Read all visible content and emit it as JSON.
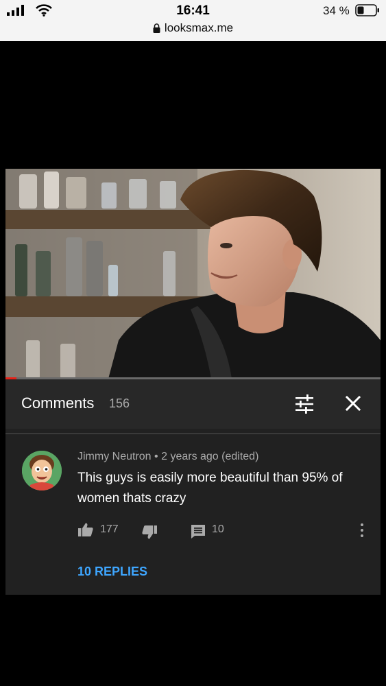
{
  "status_bar": {
    "time": "16:41",
    "url": "looksmax.me",
    "battery": "34 %",
    "icons": [
      "signal-icon",
      "wifi-icon",
      "lock-icon",
      "battery-icon"
    ]
  },
  "video": {
    "progress_fraction": 0.03,
    "colors": {
      "progress": "#e62117",
      "track": "#6a6a6a"
    }
  },
  "comments": {
    "title": "Comments",
    "count": "156",
    "icons": [
      "sort-filter-icon",
      "close-icon"
    ]
  },
  "comment": {
    "author": "Jimmy Neutron",
    "separator": "•",
    "time": "2 years ago (edited)",
    "text": "This guys is easily more beautiful than 95% of women thats crazy",
    "likes": "177",
    "reply_count": "10",
    "replies_label": "10 REPLIES",
    "icons": [
      "thumbs-up-icon",
      "thumbs-down-icon",
      "reply-icon",
      "more-vert-icon"
    ],
    "colors": {
      "link": "#3ea6ff"
    }
  }
}
